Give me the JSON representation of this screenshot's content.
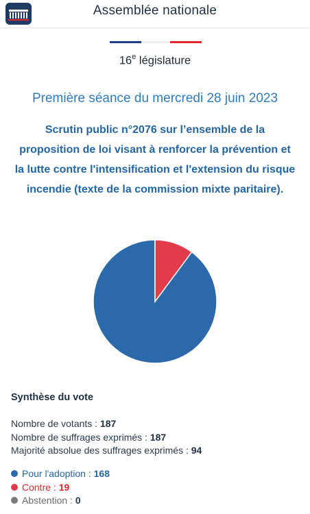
{
  "header": {
    "logo_icon": "assemblee-nationale-logo",
    "title": "Assemblée nationale"
  },
  "legislature": {
    "number": "16",
    "suffix": "e",
    "label": "législature"
  },
  "seance": "Première séance du mercredi 28 juin 2023",
  "scrutin": "Scrutin public n°2076 sur l’ensemble de la proposition de loi visant à renforcer la prévention et la lutte contre l'intensification et l'extension du risque incendie (texte de la commission mixte paritaire).",
  "chart_data": {
    "type": "pie",
    "slices": [
      {
        "name": "Pour l'adoption",
        "value": 168,
        "color": "#2c69aa"
      },
      {
        "name": "Contre",
        "value": 19,
        "color": "#e23b4c"
      },
      {
        "name": "Abstention",
        "value": 0,
        "color": "#7a7a7a"
      }
    ]
  },
  "synthese": {
    "title": "Synthèse du vote",
    "votants_label": "Nombre de votants : ",
    "votants": "187",
    "exprimes_label": "Nombre de suffrages exprimés : ",
    "exprimes": "187",
    "majorite_label": "Majorité absolue des suffrages exprimés : ",
    "majorite": "94"
  },
  "votes": {
    "pour_label": "Pour l'adoption : ",
    "pour": "168",
    "contre_label": "Contre : ",
    "contre": "19",
    "abstention_label": "Abstention : ",
    "abstention": "0"
  },
  "colors": {
    "pour": "#2c69aa",
    "contre": "#e23b4c",
    "abstention": "#7a7a7a",
    "flag_blue": "#1f3a89",
    "flag_red": "#e3242b"
  }
}
